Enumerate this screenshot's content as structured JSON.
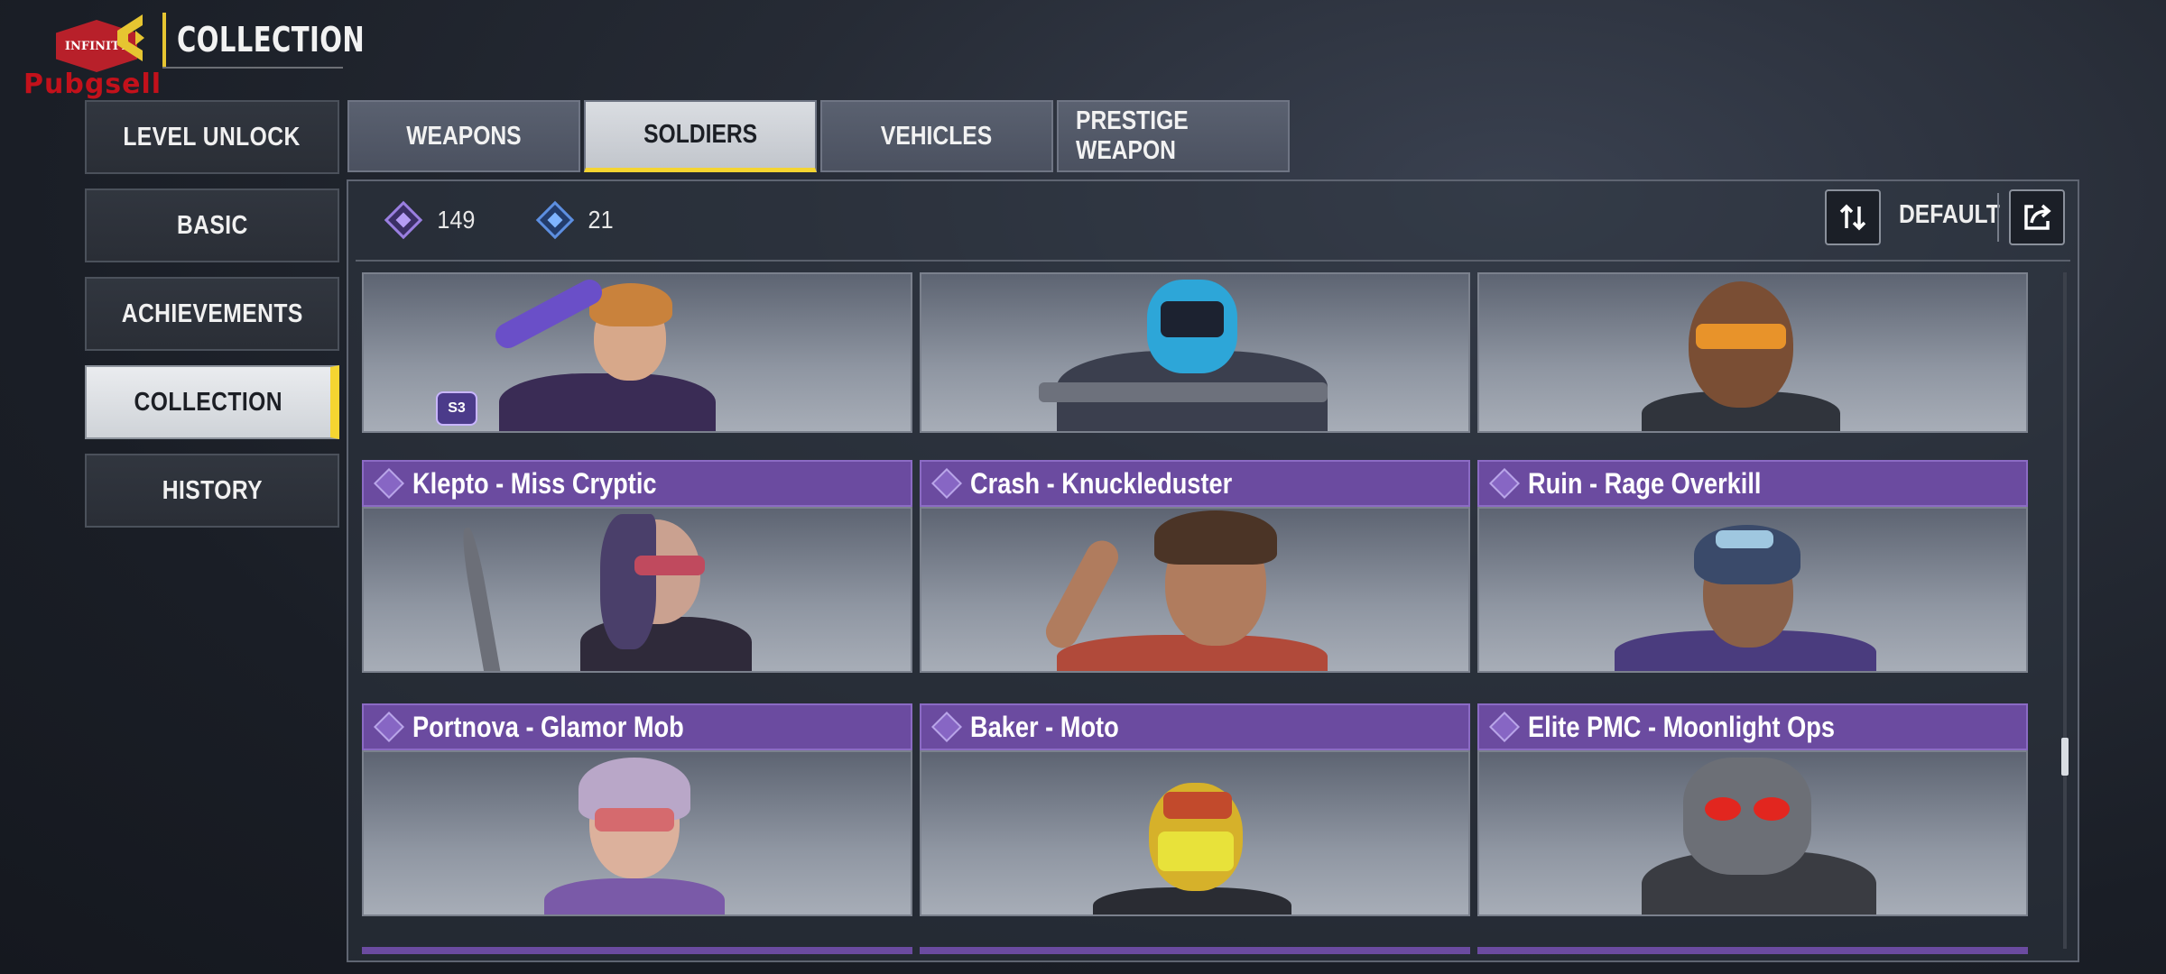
{
  "logo": {
    "badge_text": "INFINITY",
    "watermark": "Pubgsell"
  },
  "header": {
    "title": "COLLECTION"
  },
  "sidebar": {
    "items": [
      {
        "label": "LEVEL UNLOCK"
      },
      {
        "label": "BASIC"
      },
      {
        "label": "ACHIEVEMENTS"
      },
      {
        "label": "COLLECTION",
        "active": true
      },
      {
        "label": "HISTORY"
      }
    ]
  },
  "tabs": [
    {
      "label": "WEAPONS"
    },
    {
      "label": "SOLDIERS",
      "active": true
    },
    {
      "label": "VEHICLES"
    },
    {
      "label": "PRESTIGE WEAPON"
    }
  ],
  "currency": [
    {
      "icon": "purple-diamond-icon",
      "value": "149"
    },
    {
      "icon": "blue-diamond-icon",
      "value": "21"
    }
  ],
  "sort": {
    "label": "DEFAULT"
  },
  "season_badge": "S3",
  "cards": [
    {
      "name": "",
      "row": 0
    },
    {
      "name": "",
      "row": 0
    },
    {
      "name": "",
      "row": 0
    },
    {
      "name": "Klepto - Miss Cryptic"
    },
    {
      "name": "Crash - Knuckleduster"
    },
    {
      "name": "Ruin - Rage Overkill"
    },
    {
      "name": "Portnova - Glamor Mob"
    },
    {
      "name": "Baker - Moto"
    },
    {
      "name": "Elite PMC - Moonlight Ops"
    }
  ],
  "colors": {
    "accent": "#f5d531",
    "rarity_header": "#6b4ba0",
    "panel_bg": "#303642"
  }
}
